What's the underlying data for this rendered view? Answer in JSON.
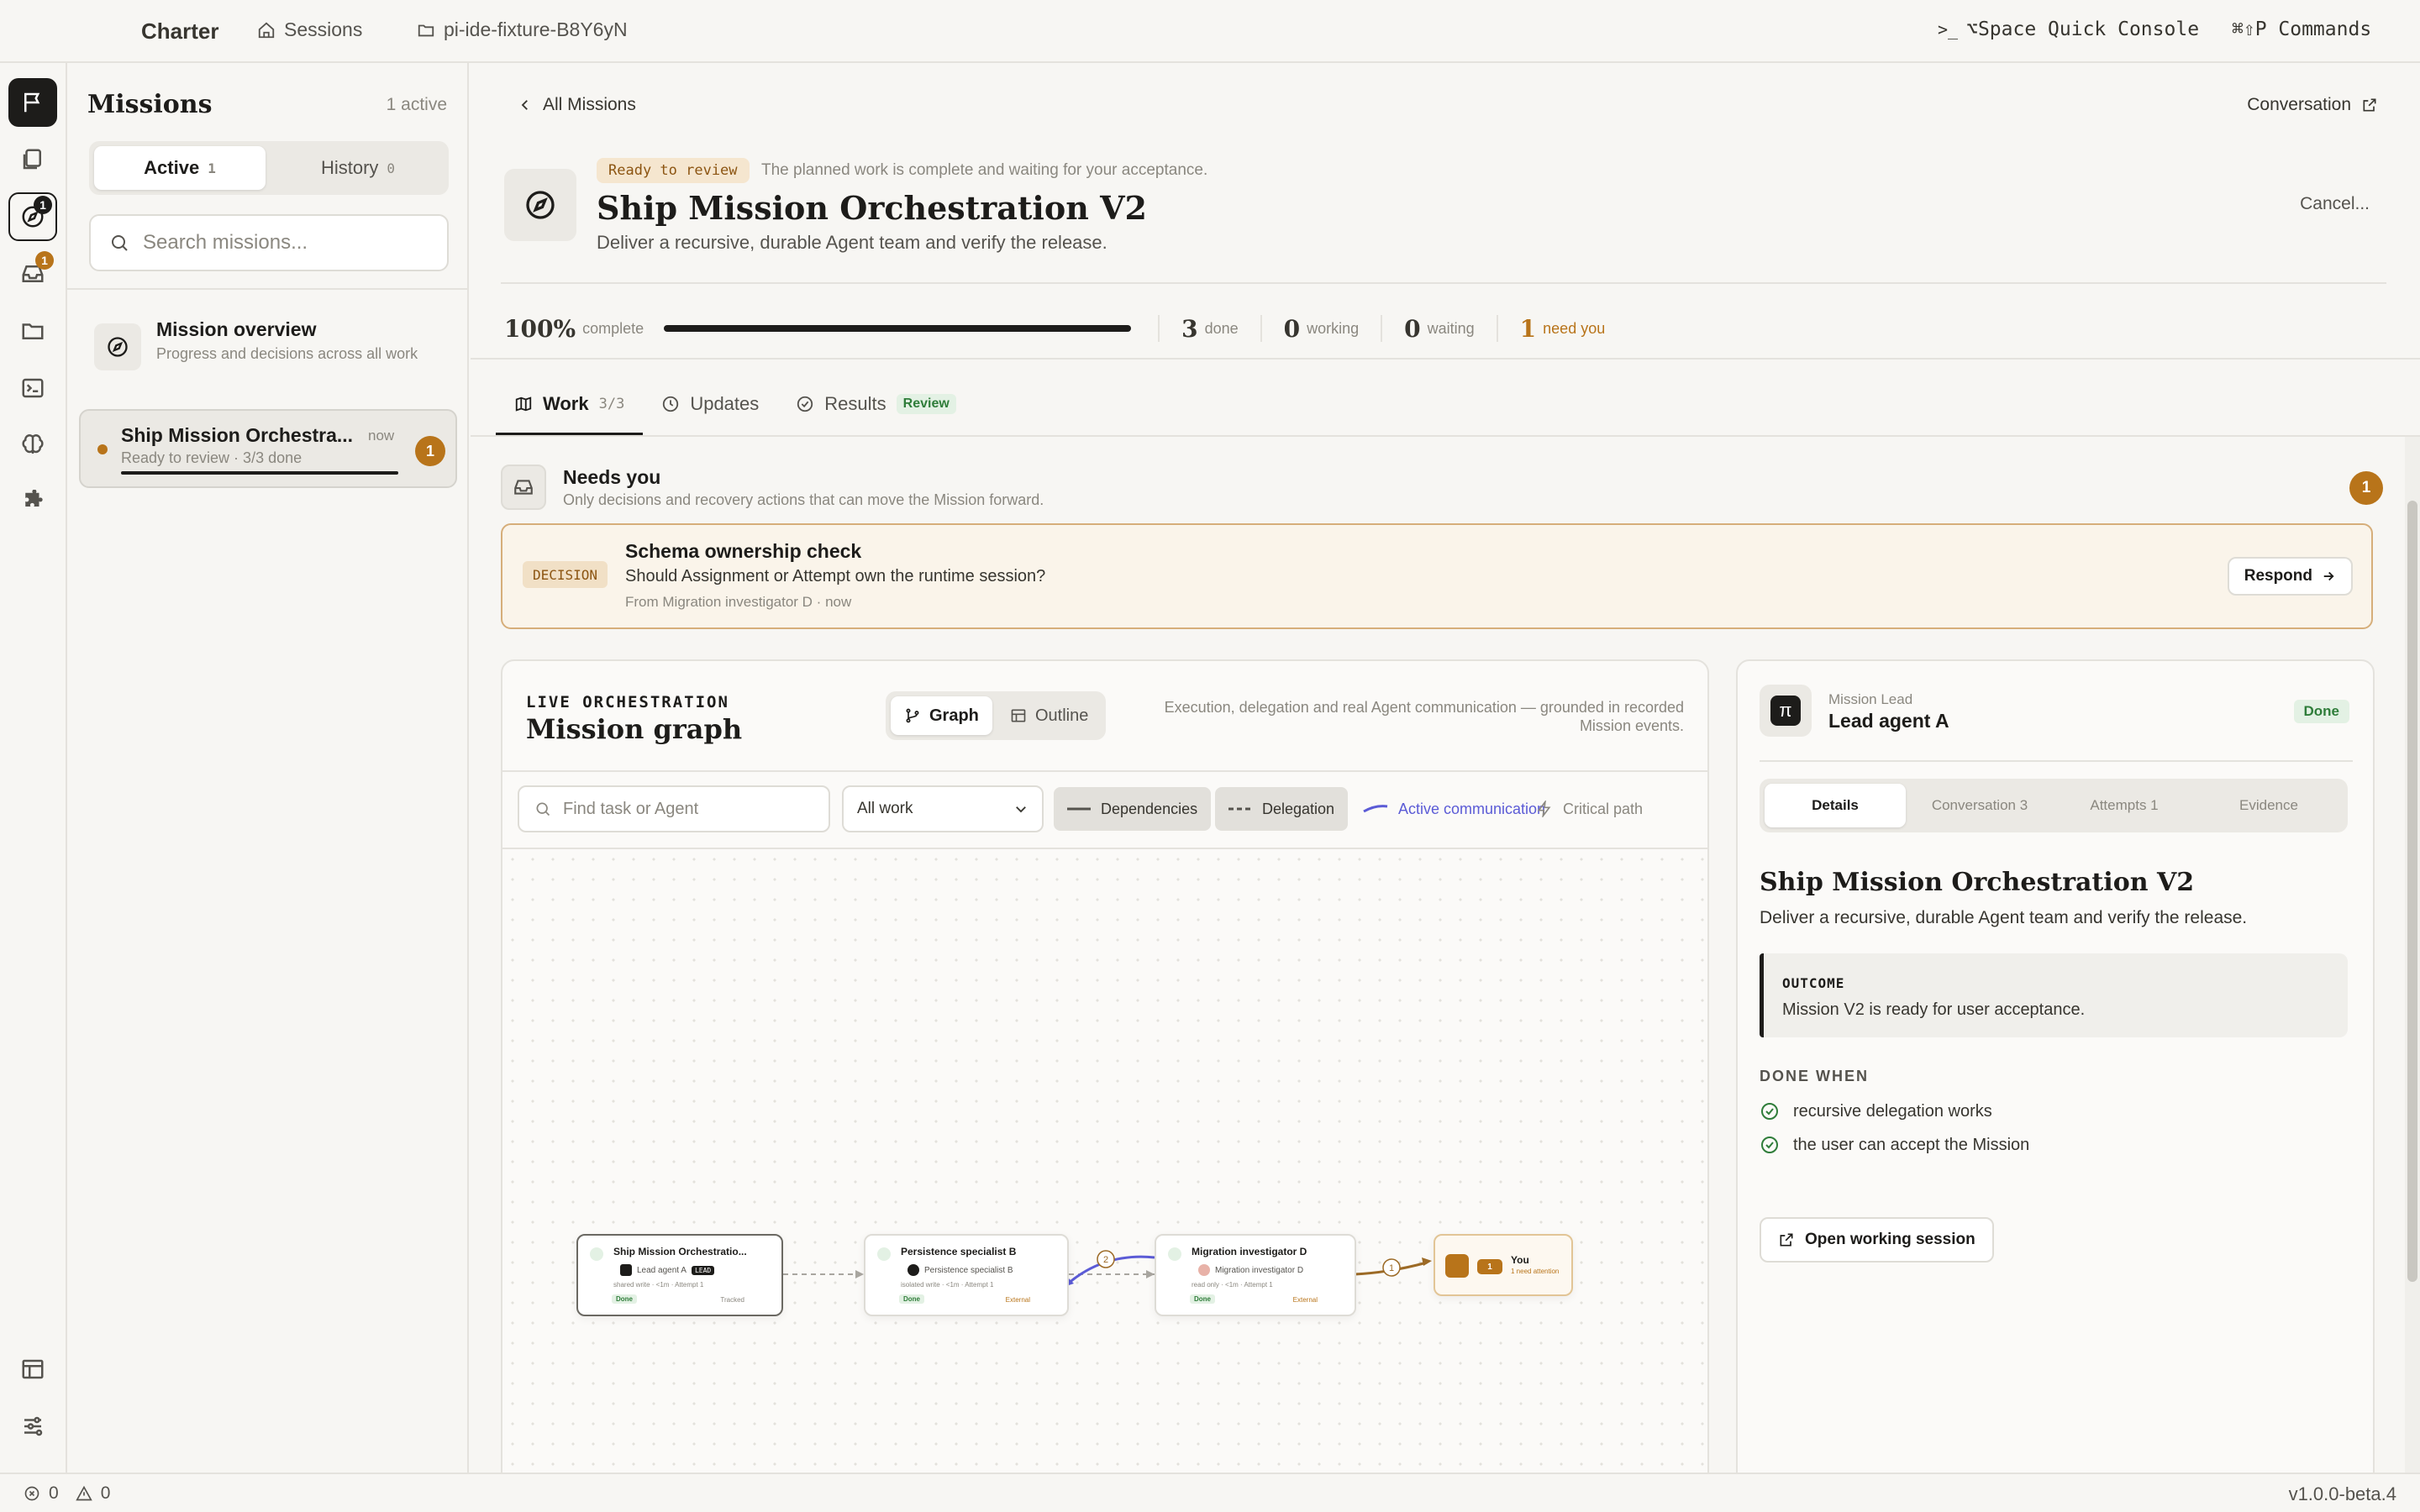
{
  "topbar": {
    "brand": "Charter",
    "sessions": "Sessions",
    "workspace": "pi-ide-fixture-B8Y6yN",
    "quick_console": "⌥Space Quick Console",
    "commands": "⌘⇧P Commands"
  },
  "rail": {
    "missions_badge": "1",
    "inbox_badge": "1",
    "badge_color": "#b8741a"
  },
  "sidebar": {
    "title": "Missions",
    "active_count": "1 active",
    "tabs": [
      {
        "label": "Active",
        "count": "1"
      },
      {
        "label": "History",
        "count": "0"
      }
    ],
    "search_placeholder": "Search missions...",
    "overview": {
      "title": "Mission overview",
      "desc": "Progress and decisions across all work"
    },
    "mission_card": {
      "name": "Ship Mission Orchestra...",
      "time": "now",
      "status": "Ready to review · 3/3 done",
      "badge": "1"
    }
  },
  "mission": {
    "back": "All Missions",
    "conversation": "Conversation",
    "status_pill": "Ready to review",
    "status_note": "The planned work is complete and waiting for your acceptance.",
    "title": "Ship Mission Orchestration V2",
    "subtitle": "Deliver a recursive, durable Agent team and verify the release.",
    "cancel": "Cancel...",
    "progress": {
      "percent": "100%",
      "percent_label": "complete",
      "fraction": 1.0,
      "done": "3",
      "done_label": "done",
      "working": "0",
      "working_label": "working",
      "waiting": "0",
      "waiting_label": "waiting",
      "need": "1",
      "need_label": "need you"
    },
    "tabs": [
      {
        "label": "Work",
        "count": "3/3"
      },
      {
        "label": "Updates"
      },
      {
        "label": "Results",
        "badge": "Review"
      }
    ]
  },
  "needs": {
    "title": "Needs you",
    "desc": "Only decisions and recovery actions that can move the Mission forward.",
    "badge": "1",
    "decision": {
      "tag": "DECISION",
      "title": "Schema ownership check",
      "question": "Should Assignment or Attempt own the runtime session?",
      "from": "From Migration investigator D · now",
      "respond": "Respond"
    }
  },
  "graph": {
    "eyebrow": "LIVE ORCHESTRATION",
    "title": "Mission graph",
    "toggle": [
      "Graph",
      "Outline"
    ],
    "desc": "Execution, delegation and real Agent communication — grounded in recorded Mission events.",
    "search_placeholder": "Find task or Agent",
    "filter": "All work",
    "legend": {
      "dependencies": "Dependencies",
      "delegation": "Delegation",
      "active": "Active communication",
      "critical": "Critical path",
      "active_color": "#5b5bd6"
    },
    "nodes": [
      {
        "title": "Ship Mission Orchestratio...",
        "agent": "Lead agent A",
        "tag": "LEAD",
        "meta": "shared write · <1m · Attempt 1",
        "status": "Done",
        "right": "Tracked"
      },
      {
        "title": "Persistence specialist B",
        "agent": "Persistence specialist B",
        "meta": "isolated write · <1m · Attempt 1",
        "status": "Done",
        "right": "External"
      },
      {
        "title": "Migration investigator D",
        "agent": "Migration investigator D",
        "meta": "read only · <1m · Attempt 1",
        "status": "Done",
        "right": "External"
      },
      {
        "title": "You",
        "sub": "1 need attention",
        "badge": "1"
      }
    ],
    "edge_counts": [
      "2",
      "1"
    ]
  },
  "details": {
    "role": "Mission Lead",
    "agent": "Lead agent A",
    "state": "Done",
    "tabs": [
      "Details",
      "Conversation 3",
      "Attempts 1",
      "Evidence"
    ],
    "title": "Ship Mission Orchestration V2",
    "subtitle": "Deliver a recursive, durable Agent team and verify the release.",
    "outcome_label": "OUTCOME",
    "outcome": "Mission V2 is ready for user acceptance.",
    "done_when_label": "DONE WHEN",
    "criteria": [
      "recursive delegation works",
      "the user can accept the Mission"
    ],
    "open_session": "Open working session"
  },
  "status": {
    "errors": "0",
    "warnings": "0",
    "version": "v1.0.0-beta.4"
  }
}
